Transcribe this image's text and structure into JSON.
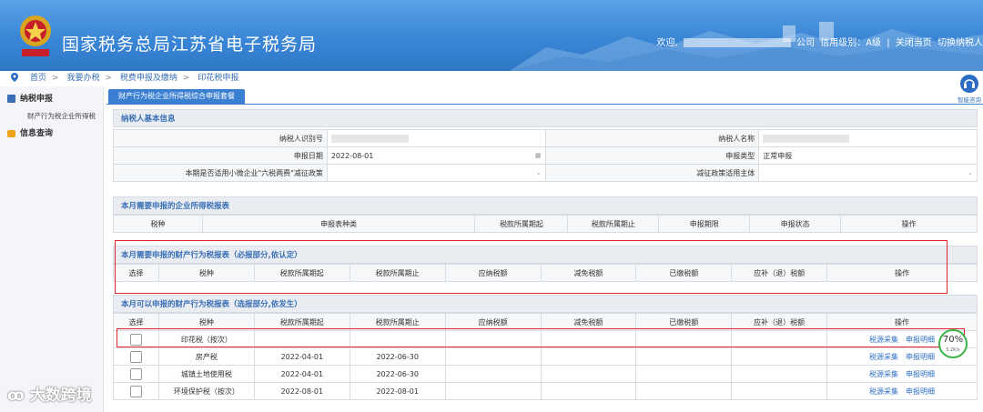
{
  "header": {
    "title": "国家税务总局江苏省电子税务局",
    "welcome": "欢迎,",
    "company_suffix": "公司",
    "credit_level": "信用级别：A级",
    "close_page": "关闭当页",
    "switch_taxpayer": "切换纳税人"
  },
  "breadcrumb": [
    "首页",
    "我要办税",
    "税费申报及缴纳",
    "印花税申报"
  ],
  "sidebar": {
    "items": [
      {
        "label": "纳税申报",
        "icon": "square-icon"
      },
      {
        "label": "财产行为税企业所得税",
        "icon": ""
      },
      {
        "label": "信息查询",
        "icon": "message-icon"
      }
    ]
  },
  "tab": {
    "label": "财产行为税企业所得税综合申报套餐"
  },
  "help": {
    "label": "智能咨询"
  },
  "basic": {
    "title": "纳税人基本信息",
    "taxpayer_id_label": "纳税人识别号",
    "taxpayer_name_label": "纳税人名称",
    "declare_date_label": "申报日期",
    "declare_date_value": "2022-08-01",
    "declare_type_label": "申报类型",
    "declare_type_value": "正常申报",
    "small_enterprise_label": "本期是否适用小微企业\"六税两费\"减征政策",
    "policy_subject_label": "减征政策适用主体"
  },
  "cit": {
    "title": "本月需要申报的企业所得税报表",
    "columns": [
      "税种",
      "申报表种类",
      "税款所属期起",
      "税款所属期止",
      "申报期限",
      "申报状态",
      "操作"
    ]
  },
  "required": {
    "title": "本月需要申报的财产行为税报表（必报部分,依认定）",
    "columns": [
      "选择",
      "税种",
      "税款所属期起",
      "税款所属期止",
      "应纳税额",
      "减免税额",
      "已缴税额",
      "应补（退）税额",
      "操作"
    ]
  },
  "optional": {
    "title": "本月可以申报的财产行为税报表（选报部分,依发生）",
    "columns": [
      "选择",
      "税种",
      "税款所属期起",
      "税款所属期止",
      "应纳税额",
      "减免税额",
      "已缴税额",
      "应补（退）税额",
      "操作"
    ],
    "rows": [
      {
        "tax": "印花税（按次）",
        "start": "",
        "end": "",
        "op1": "税源采集",
        "op2": "申报明细"
      },
      {
        "tax": "房产税",
        "start": "2022-04-01",
        "end": "2022-06-30",
        "op1": "税源采集",
        "op2": "申报明细"
      },
      {
        "tax": "城镇土地使用税",
        "start": "2022-04-01",
        "end": "2022-06-30",
        "op1": "税源采集",
        "op2": "申报明细"
      },
      {
        "tax": "环境保护税（按次）",
        "start": "2022-08-01",
        "end": "2022-08-01",
        "op1": "税源采集",
        "op2": "申报明细"
      }
    ]
  },
  "gauge": {
    "percent": "70%",
    "speed": "5.2K/s",
    "fraction": 0.7
  },
  "watermark": "大数跨境",
  "colors": {
    "accent": "#3a7fd2",
    "highlight_box": "#e0262c",
    "link": "#2f6fc4"
  }
}
